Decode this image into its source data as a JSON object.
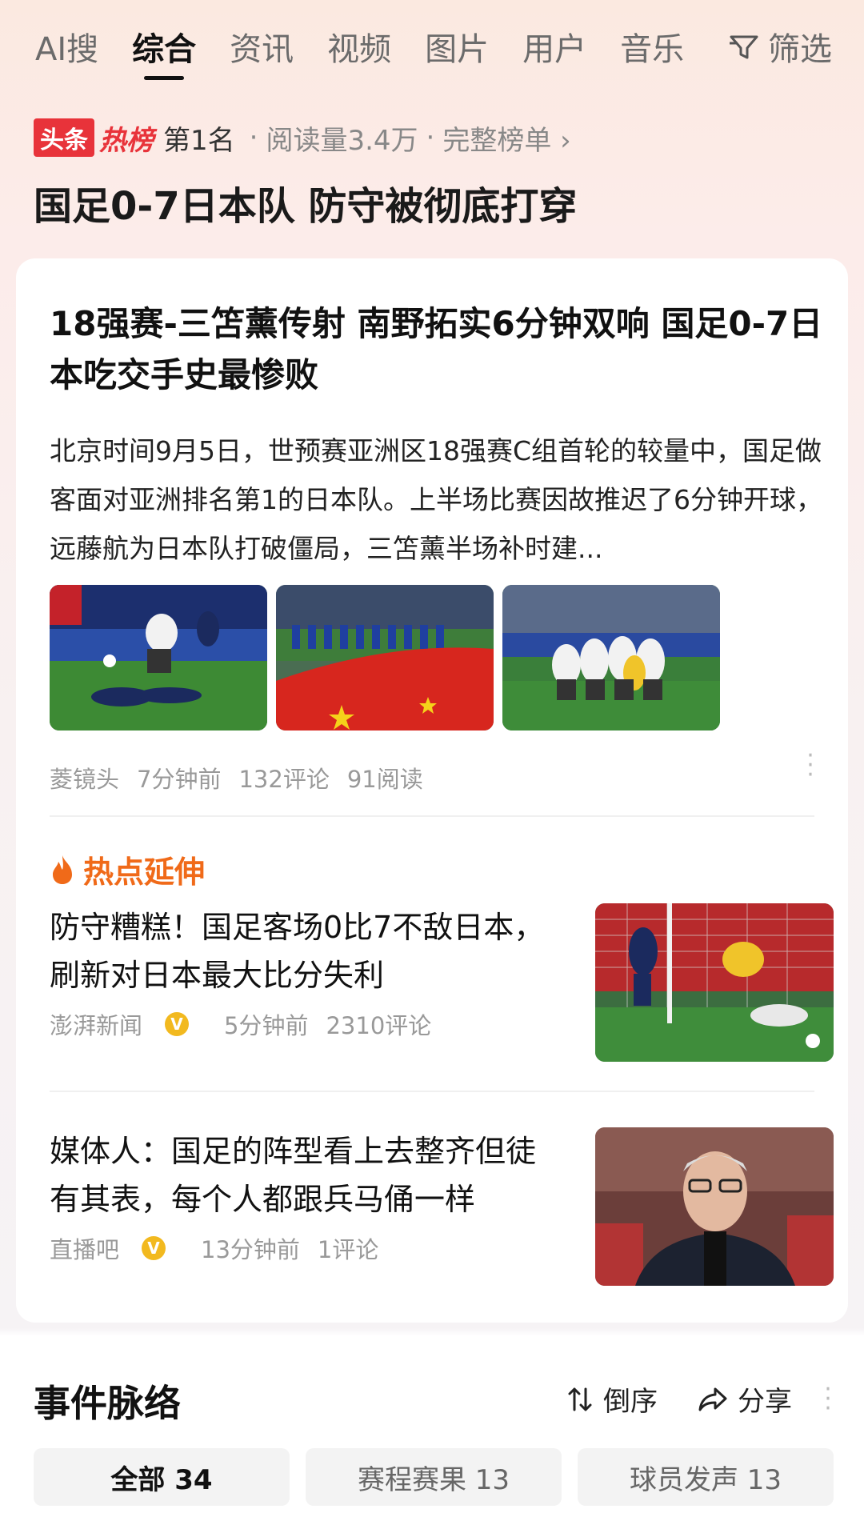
{
  "tabs": [
    {
      "label": "AI搜",
      "active": false
    },
    {
      "label": "综合",
      "active": true
    },
    {
      "label": "资讯",
      "active": false
    },
    {
      "label": "视频",
      "active": false
    },
    {
      "label": "图片",
      "active": false
    },
    {
      "label": "用户",
      "active": false
    },
    {
      "label": "音乐",
      "active": false
    }
  ],
  "filter_label": "筛选",
  "hot": {
    "logo_box": "头条",
    "logo_text": "热榜",
    "rank": "第1名",
    "reads": "阅读量3.4万",
    "full_list": "完整榜单 ›",
    "title": "国足0-7日本队 防守被彻底打穿"
  },
  "article": {
    "title": "18强赛-三笘薰传射 南野拓实6分钟双响 国足0-7日本吃交手史最惨败",
    "summary": "北京时间9月5日，世预赛亚洲区18强赛C组首轮的较量中，国足做客面对亚洲排名第1的日本队。上半场比赛因故推迟了6分钟开球，远藤航为日本队打破僵局，三笘薰半场补时建...",
    "source": "菱镜头",
    "time": "7分钟前",
    "comments": "132评论",
    "reads": "91阅读"
  },
  "extension": {
    "heading": "热点延伸",
    "items": [
      {
        "title": "防守糟糕！国足客场0比7不敌日本，刷新对日本最大比分失利",
        "source": "澎湃新闻",
        "verified": true,
        "time": "5分钟前",
        "comments": "2310评论"
      },
      {
        "title": "媒体人：国足的阵型看上去整齐但徒有其表，每个人都跟兵马俑一样",
        "source": "直播吧",
        "verified": true,
        "time": "13分钟前",
        "comments": "1评论"
      }
    ]
  },
  "timeline": {
    "title": "事件脉络",
    "sort_label": "倒序",
    "share_label": "分享",
    "chips": [
      {
        "label": "全部 34",
        "active": true
      },
      {
        "label": "赛程赛果 13",
        "active": false
      },
      {
        "label": "球员发声 13",
        "active": false
      }
    ]
  },
  "colors": {
    "accent_orange": "#f06a19",
    "hot_red": "#e8333a",
    "verified_gold": "#f2b91f"
  }
}
